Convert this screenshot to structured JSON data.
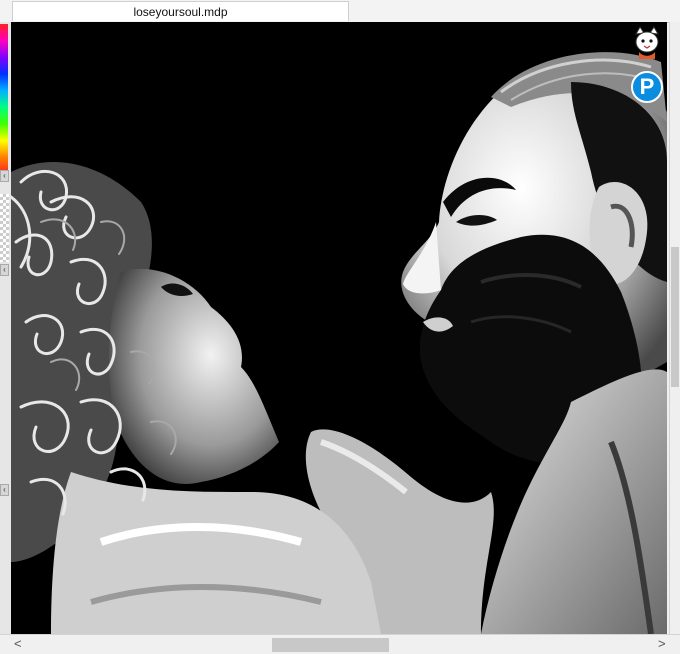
{
  "document": {
    "filename": "loseyoursoul.mdp"
  },
  "badges": {
    "pixiv_letter": "P"
  },
  "scrollbar": {
    "left_arrow": "<",
    "right_arrow": ">"
  },
  "toolbar_left": {
    "expand_glyph": "‹"
  },
  "colors": {
    "canvas_bg": "#000000",
    "accent_blue": "#0a8de0"
  }
}
